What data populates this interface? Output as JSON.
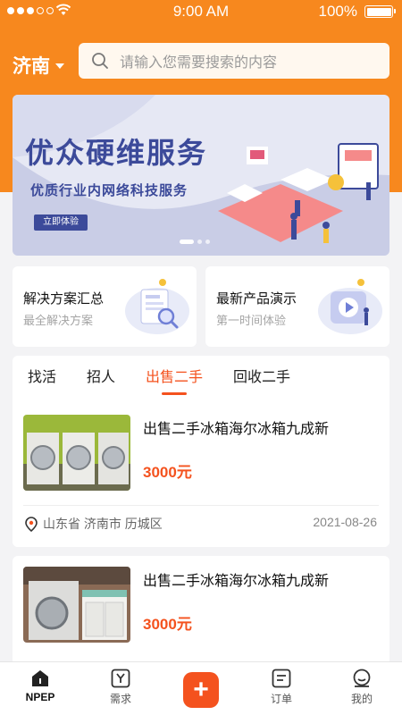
{
  "status_bar": {
    "time": "9:00 AM",
    "battery": "100%"
  },
  "header": {
    "city": "济南",
    "search_placeholder": "请输入您需要搜索的内容"
  },
  "banner": {
    "title": "优众硬维服务",
    "subtitle": "优质行业内网络科技服务",
    "cta": "立即体验"
  },
  "features": [
    {
      "title": "解决方案汇总",
      "subtitle": "最全解决方案",
      "icon": "document-search-icon"
    },
    {
      "title": "最新产品演示",
      "subtitle": "第一时间体验",
      "icon": "video-play-icon"
    }
  ],
  "tabs": [
    {
      "label": "找活"
    },
    {
      "label": "招人"
    },
    {
      "label": "出售二手",
      "active": true
    },
    {
      "label": "回收二手"
    }
  ],
  "listings": [
    {
      "title": "出售二手冰箱海尔冰箱九成新",
      "price": "3000元",
      "location": "山东省 济南市 历城区",
      "date": "2021-08-26"
    },
    {
      "title": "出售二手冰箱海尔冰箱九成新",
      "price": "3000元"
    }
  ],
  "nav": [
    {
      "label": "NPEP",
      "icon": "home-icon",
      "active": true
    },
    {
      "label": "需求",
      "icon": "demand-icon"
    },
    {
      "label": "",
      "icon": "plus-icon"
    },
    {
      "label": "订单",
      "icon": "order-icon"
    },
    {
      "label": "我的",
      "icon": "profile-icon"
    }
  ],
  "colors": {
    "brand": "#f7881e",
    "accent": "#f4521e",
    "banner_text": "#3c4a9a"
  }
}
